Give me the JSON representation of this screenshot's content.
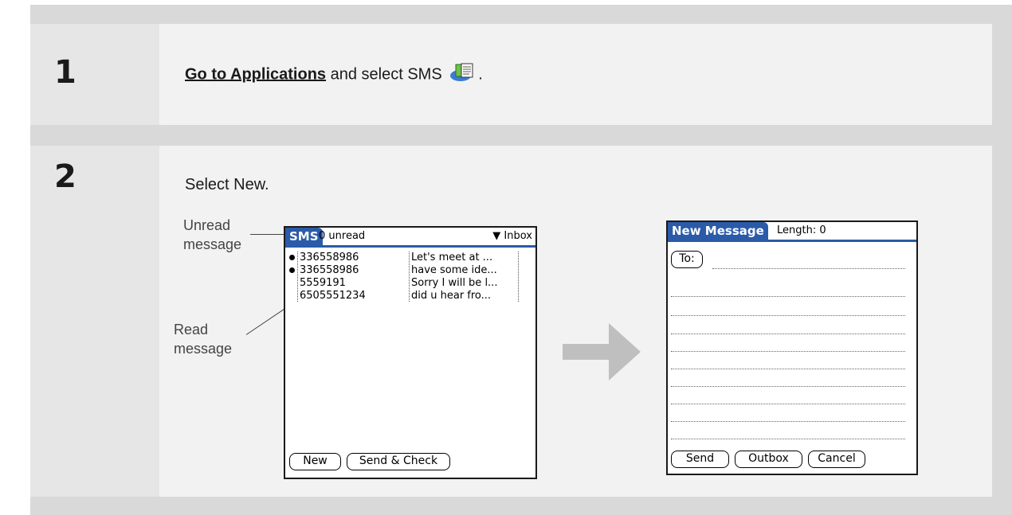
{
  "steps": [
    {
      "number": "1",
      "link_text": "Go to Applications",
      "text_after": " and select SMS ",
      "text_end": "."
    },
    {
      "number": "2",
      "text": "Select New."
    }
  ],
  "sms_screen": {
    "app_tab": "SMS",
    "unread_status": "0 unread",
    "folder": "Inbox",
    "messages": [
      {
        "from": "336558986",
        "preview": "Let's meet at ...",
        "unread": true
      },
      {
        "from": "336558986",
        "preview": "have some ide...",
        "unread": true
      },
      {
        "from": "5559191",
        "preview": "Sorry I will be l...",
        "unread": false
      },
      {
        "from": "6505551234",
        "preview": "did u hear fro...",
        "unread": false
      }
    ],
    "buttons": {
      "new": "New",
      "send_check": "Send & Check"
    }
  },
  "callouts": {
    "unread": "Unread message",
    "read": "Read message"
  },
  "new_message_screen": {
    "title": "New Message",
    "length_label": "Length: 0",
    "to_button": "To:",
    "buttons": {
      "send": "Send",
      "outbox": "Outbox",
      "cancel": "Cancel"
    }
  },
  "colors": {
    "palm_accent": "#2b5aa8",
    "arrow": "#bfbfbf"
  }
}
